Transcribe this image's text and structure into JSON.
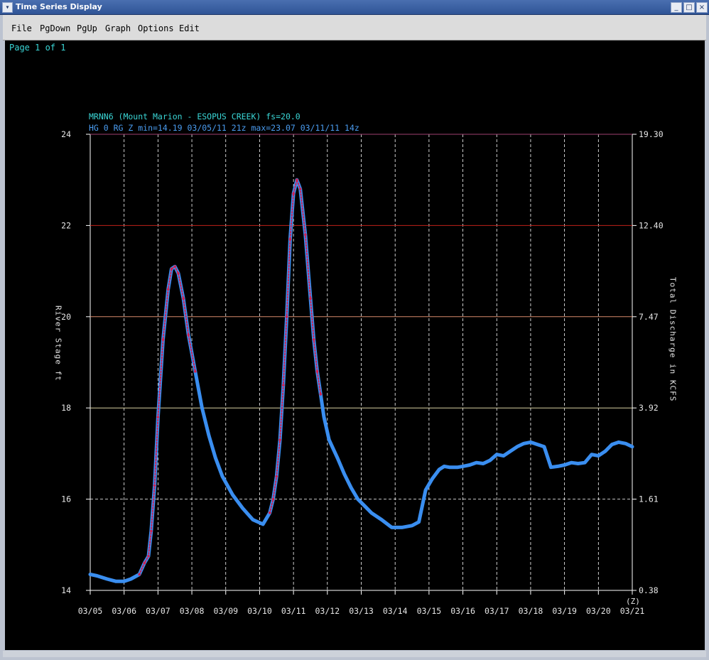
{
  "window": {
    "title": "Time Series Display",
    "title_icon": "chevron-down-icon",
    "controls": [
      "minimize-icon",
      "maximize-icon",
      "close-icon"
    ]
  },
  "menu": {
    "items": [
      {
        "id": "file",
        "label": "File"
      },
      {
        "id": "pgdown",
        "label": "PgDown"
      },
      {
        "id": "pgup",
        "label": "PgUp"
      },
      {
        "id": "graph",
        "label": "Graph"
      },
      {
        "id": "options",
        "label": "Options"
      },
      {
        "id": "edit",
        "label": "Edit"
      }
    ]
  },
  "page_label": "Page 1 of 1",
  "chart_data": {
    "type": "line",
    "title": "MRNN6 (Mount Marion - ESOPUS CREEK) fs=20.0",
    "subtitle": "HG 0 RG Z min=14.19 03/05/11 21z max=23.07 03/11/11 14z",
    "ylabel": "River Stage ft",
    "y2label": "Total Discharge in KCFS",
    "xunit": "(Z)",
    "ylim": [
      14,
      24
    ],
    "xlim": [
      0,
      16
    ],
    "x_tick_labels": [
      "03/05",
      "03/06",
      "03/07",
      "03/08",
      "03/09",
      "03/10",
      "03/11",
      "03/12",
      "03/13",
      "03/14",
      "03/15",
      "03/16",
      "03/17",
      "03/18",
      "03/19",
      "03/20",
      "03/21"
    ],
    "y_ticks": [
      14,
      16,
      18,
      20,
      22,
      24
    ],
    "y2_ticks": [
      "0.38",
      "1.61",
      "3.92",
      "7.47",
      "12.40",
      "19.30"
    ],
    "threshold_lines": [
      {
        "y": 18,
        "color": "#d8d0a0"
      },
      {
        "y": 20,
        "color": "#d88a6a"
      },
      {
        "y": 22,
        "color": "#c02018"
      },
      {
        "y": 24,
        "color": "#a04070"
      }
    ],
    "grid": true,
    "colors": {
      "observed": "#3a8ef0",
      "forecast": "#d02050",
      "axis_text": "#e6e6e6",
      "title": "#3ad6d6",
      "subtitle": "#4a9cf0"
    },
    "series": [
      {
        "name": "observed",
        "x": [
          0,
          0.2,
          0.5,
          0.75,
          1,
          1.2,
          1.45,
          1.6,
          1.72,
          1.8,
          1.9,
          2.0,
          2.15,
          2.3,
          2.4,
          2.5,
          2.6,
          2.75,
          2.9,
          3.1,
          3.3,
          3.5,
          3.7,
          3.9,
          4.2,
          4.5,
          4.8,
          5.1,
          5.3,
          5.4,
          5.5,
          5.6,
          5.7,
          5.8,
          5.9,
          6.0,
          6.1,
          6.2,
          6.35,
          6.5,
          6.6,
          6.7,
          6.8,
          6.9,
          7.05,
          7.3,
          7.5,
          7.7,
          7.9,
          8.1,
          8.3,
          8.6,
          8.9,
          9.2,
          9.5,
          9.7,
          9.9,
          10.1,
          10.3,
          10.45,
          10.6,
          10.85,
          11.0,
          11.2,
          11.4,
          11.6,
          11.8,
          12.0,
          12.2,
          12.4,
          12.6,
          12.8,
          13.0,
          13.2,
          13.4,
          13.6,
          13.8,
          14.0,
          14.2,
          14.4,
          14.6,
          14.8,
          15.0,
          15.2,
          15.4,
          15.6,
          15.8,
          16.0
        ],
        "y": [
          14.35,
          14.32,
          14.25,
          14.2,
          14.2,
          14.25,
          14.35,
          14.6,
          14.75,
          15.3,
          16.3,
          17.8,
          19.5,
          20.6,
          21.05,
          21.1,
          20.95,
          20.4,
          19.6,
          18.8,
          18.0,
          17.4,
          16.9,
          16.5,
          16.1,
          15.8,
          15.55,
          15.45,
          15.7,
          16.0,
          16.5,
          17.3,
          18.5,
          20.0,
          21.7,
          22.7,
          23.0,
          22.8,
          21.8,
          20.4,
          19.5,
          18.8,
          18.3,
          17.8,
          17.3,
          16.9,
          16.55,
          16.25,
          16.0,
          15.85,
          15.7,
          15.55,
          15.38,
          15.38,
          15.42,
          15.5,
          16.2,
          16.45,
          16.65,
          16.72,
          16.7,
          16.7,
          16.72,
          16.75,
          16.8,
          16.78,
          16.85,
          16.98,
          16.95,
          17.05,
          17.15,
          17.22,
          17.25,
          17.2,
          17.15,
          16.7,
          16.72,
          16.75,
          16.8,
          16.78,
          16.8,
          16.98,
          16.95,
          17.05,
          17.2,
          17.25,
          17.22,
          17.15
        ]
      },
      {
        "name": "forecast",
        "x": [
          1.45,
          1.6,
          1.72,
          1.8,
          1.9,
          2.0,
          2.15,
          2.3,
          2.4,
          2.5,
          2.6,
          2.75,
          2.9,
          3.1,
          5.3,
          5.4,
          5.5,
          5.6,
          5.7,
          5.8,
          5.9,
          6.0,
          6.1,
          6.2,
          6.35,
          6.5,
          6.6,
          6.7,
          6.8
        ],
        "y": [
          14.35,
          14.6,
          14.75,
          15.3,
          16.3,
          17.8,
          19.5,
          20.6,
          21.05,
          21.1,
          20.95,
          20.4,
          19.6,
          18.8,
          15.7,
          16.0,
          16.5,
          17.3,
          18.5,
          20.0,
          21.7,
          22.7,
          23.0,
          22.8,
          21.8,
          20.4,
          19.5,
          18.8,
          18.3
        ]
      }
    ]
  }
}
